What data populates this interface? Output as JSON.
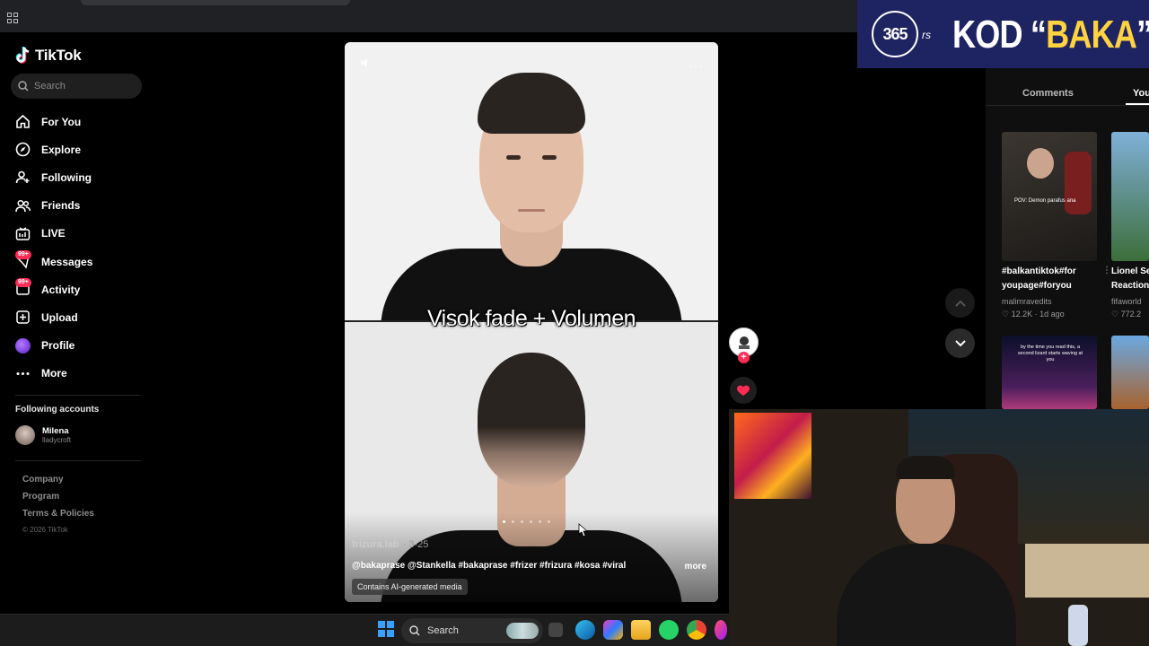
{
  "sidebar": {
    "logo": "TikTok",
    "search_placeholder": "Search",
    "nav": [
      {
        "label": "For You"
      },
      {
        "label": "Explore"
      },
      {
        "label": "Following"
      },
      {
        "label": "Friends"
      },
      {
        "label": "LIVE"
      },
      {
        "label": "Messages",
        "badge": "99+"
      },
      {
        "label": "Activity",
        "badge": "99+"
      },
      {
        "label": "Upload"
      },
      {
        "label": "Profile"
      },
      {
        "label": "More"
      }
    ],
    "following_title": "Following accounts",
    "following": [
      {
        "name": "Milena",
        "handle": "lladycroft"
      }
    ],
    "footer": [
      "Company",
      "Program",
      "Terms & Policies"
    ],
    "copyright": "© 2026 TikTok"
  },
  "video": {
    "overlay_text": "Visok fade + Volumen",
    "author": "frizura.lab",
    "date": "3-25",
    "description": "@bakaprase @Stankella #bakaprase #frizer #frizura #kosa #viral",
    "more": "more",
    "ai_label": "Contains AI-generated media"
  },
  "right_panel": {
    "tabs": [
      "Comments",
      "You"
    ],
    "items": [
      {
        "title_line1": "#balkantiktok#for",
        "title_line2": "youpage#foryou",
        "user": "malimravedits",
        "likes": "12.2K",
        "age": "1d ago",
        "thumb_caption": "POV: Demon parafus ana"
      },
      {
        "title_line1": "Lionel Se",
        "title_line2": "Reaction",
        "user": "fifaworld",
        "likes": "772.2"
      },
      {
        "thumb_caption": "by the time you read this, a second lizard starts waving at you"
      }
    ]
  },
  "stream": {
    "promo_number": "365",
    "promo_suffix": "rs",
    "promo_prefix": "KOD “",
    "promo_code": "BAKA",
    "promo_suffix_quote": "”"
  },
  "taskbar": {
    "search_label": "Search"
  },
  "colors": {
    "accent": "#fe2c55",
    "promo_bg": "#1e2461",
    "promo_yellow": "#ffd23f"
  }
}
